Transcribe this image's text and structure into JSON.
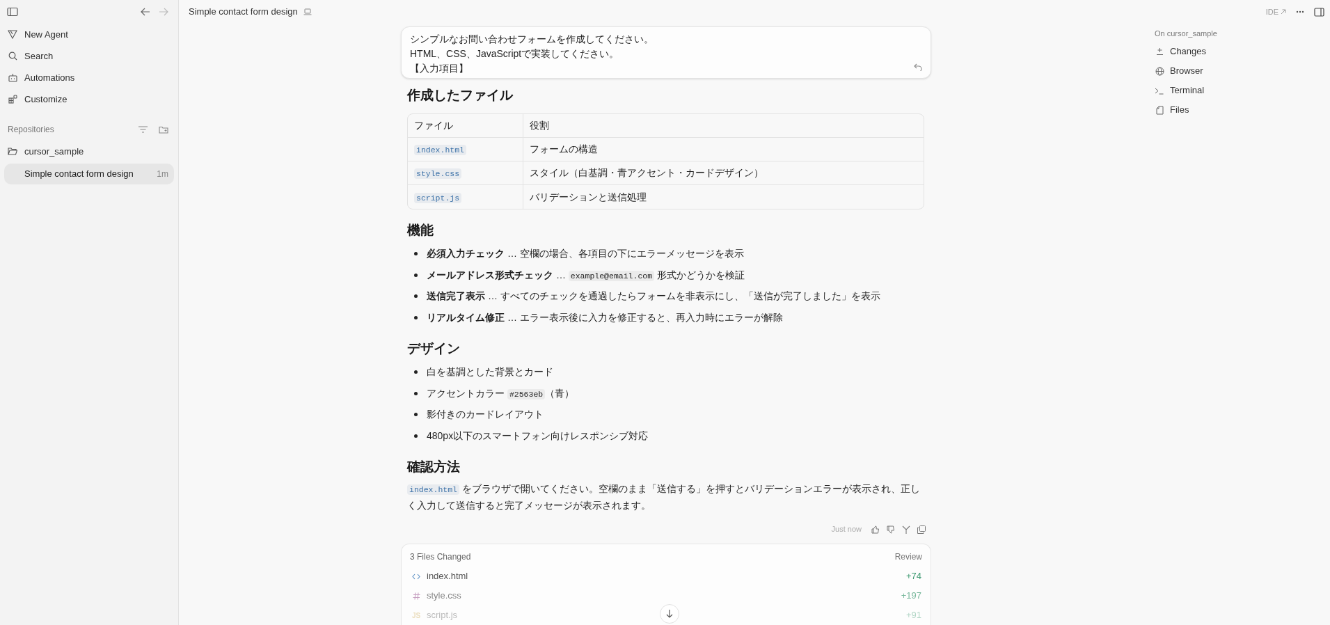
{
  "sidebar": {
    "nav_items": [
      {
        "label": "New Agent"
      },
      {
        "label": "Search"
      },
      {
        "label": "Automations"
      },
      {
        "label": "Customize"
      }
    ],
    "section_title": "Repositories",
    "repositories": [
      {
        "name": "cursor_sample",
        "expanded": true,
        "children": [
          {
            "title": "Simple contact form design",
            "time": "1m",
            "selected": true
          }
        ]
      }
    ]
  },
  "header": {
    "title": "Simple contact form design",
    "ide_label": "IDE"
  },
  "user_message": {
    "lines": [
      "シンプルなお問い合わせフォームを作成してください。",
      "HTML、CSS、JavaScriptで実装してください。",
      "【入力項目】"
    ]
  },
  "response": [
    {
      "kind": "heading",
      "text": "作成したファイル"
    },
    {
      "kind": "table",
      "columns": [
        "ファイル",
        "役割"
      ],
      "rows": [
        [
          {
            "kind": "file",
            "text": "index.html"
          },
          {
            "kind": "text",
            "text": "フォームの構造"
          }
        ],
        [
          {
            "kind": "file",
            "text": "style.css"
          },
          {
            "kind": "text",
            "text": "スタイル（白基調・青アクセント・カードデザイン）"
          }
        ],
        [
          {
            "kind": "file",
            "text": "script.js"
          },
          {
            "kind": "text",
            "text": "バリデーションと送信処理"
          }
        ]
      ]
    },
    {
      "kind": "heading",
      "text": "機能"
    },
    {
      "kind": "list",
      "items": [
        [
          {
            "kind": "bold",
            "text": "必須入力チェック"
          },
          {
            "kind": "text",
            "text": " … 空欄の場合、各項目の下にエラーメッセージを表示"
          }
        ],
        [
          {
            "kind": "bold",
            "text": "メールアドレス形式チェック"
          },
          {
            "kind": "text",
            "text": " … "
          },
          {
            "kind": "code",
            "text": "example@email.com"
          },
          {
            "kind": "text",
            "text": " 形式かどうかを検証"
          }
        ],
        [
          {
            "kind": "bold",
            "text": "送信完了表示"
          },
          {
            "kind": "text",
            "text": " … すべてのチェックを通過したらフォームを非表示にし、「送信が完了しました」を表示"
          }
        ],
        [
          {
            "kind": "bold",
            "text": "リアルタイム修正"
          },
          {
            "kind": "text",
            "text": " … エラー表示後に入力を修正すると、再入力時にエラーが解除"
          }
        ]
      ]
    },
    {
      "kind": "heading",
      "text": "デザイン"
    },
    {
      "kind": "list",
      "items": [
        [
          {
            "kind": "text",
            "text": "白を基調とした背景とカード"
          }
        ],
        [
          {
            "kind": "text",
            "text": "アクセントカラー "
          },
          {
            "kind": "code",
            "text": "#2563eb"
          },
          {
            "kind": "text",
            "text": "（青）"
          }
        ],
        [
          {
            "kind": "text",
            "text": "影付きのカードレイアウト"
          }
        ],
        [
          {
            "kind": "text",
            "text": "480px以下のスマートフォン向けレスポンシブ対応"
          }
        ]
      ]
    },
    {
      "kind": "heading",
      "text": "確認方法"
    },
    {
      "kind": "paragraph",
      "segments": [
        {
          "kind": "file",
          "text": "index.html"
        },
        {
          "kind": "text",
          "text": " をブラウザで開いてください。空欄のまま「送信する」を押すとバリデーションエラーが表示され、正しく入力して送信すると完了メッセージが表示されます。"
        }
      ]
    }
  ],
  "message_meta": {
    "time": "Just now"
  },
  "files_changed": {
    "title": "3 Files Changed",
    "action": "Review",
    "files": [
      {
        "name": "index.html",
        "kind": "html",
        "additions": "+74"
      },
      {
        "name": "style.css",
        "kind": "css",
        "additions": "+197"
      },
      {
        "name": "script.js",
        "kind": "js",
        "icon_label": "JS",
        "additions": "+91"
      }
    ]
  },
  "right_panel": {
    "title": "On cursor_sample",
    "items": [
      {
        "label": "Changes"
      },
      {
        "label": "Browser"
      },
      {
        "label": "Terminal"
      },
      {
        "label": "Files"
      }
    ]
  }
}
